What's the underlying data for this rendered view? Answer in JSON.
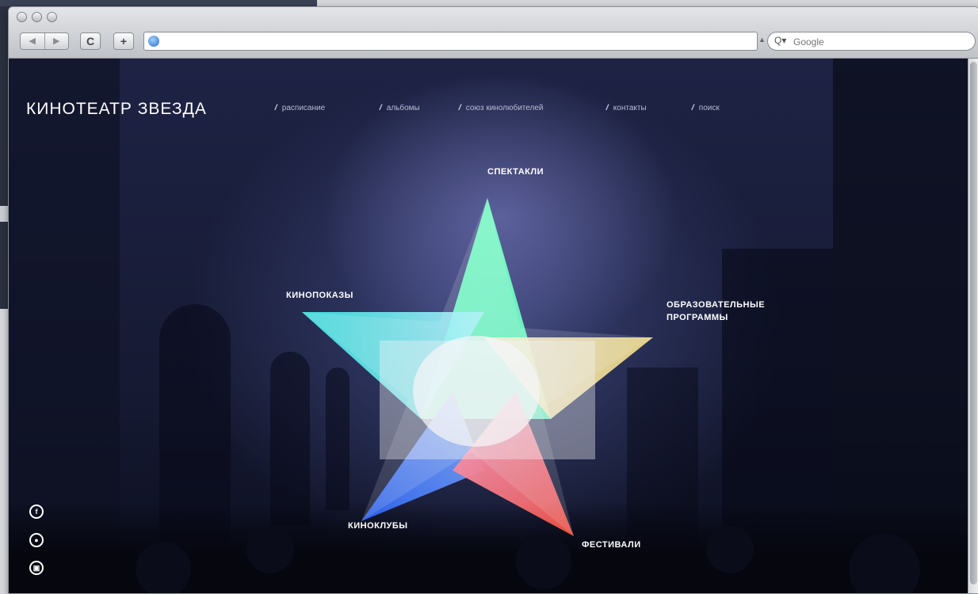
{
  "browser": {
    "back_label": "◀",
    "forward_label": "▶",
    "reload_label": "C",
    "add_label": "+",
    "url_value": "",
    "search_placeholder": "Google"
  },
  "site": {
    "logo": "КИНОТЕАТР ЗВЕЗДА",
    "nav": [
      "расписание",
      "альбомы",
      "союз кинолюбителей",
      "контакты",
      "поиск"
    ],
    "categories": {
      "top": "СПЕКТАКЛИ",
      "left": "КИНОПОКАЗЫ",
      "right_line1": "ОБРАЗОВАТЕЛЬНЫЕ",
      "right_line2": "ПРОГРАММЫ",
      "bottom_left": "КИНОКЛУБЫ",
      "bottom_right": "ФЕСТИВАЛИ"
    },
    "social": [
      "f",
      "●",
      "▣"
    ]
  }
}
